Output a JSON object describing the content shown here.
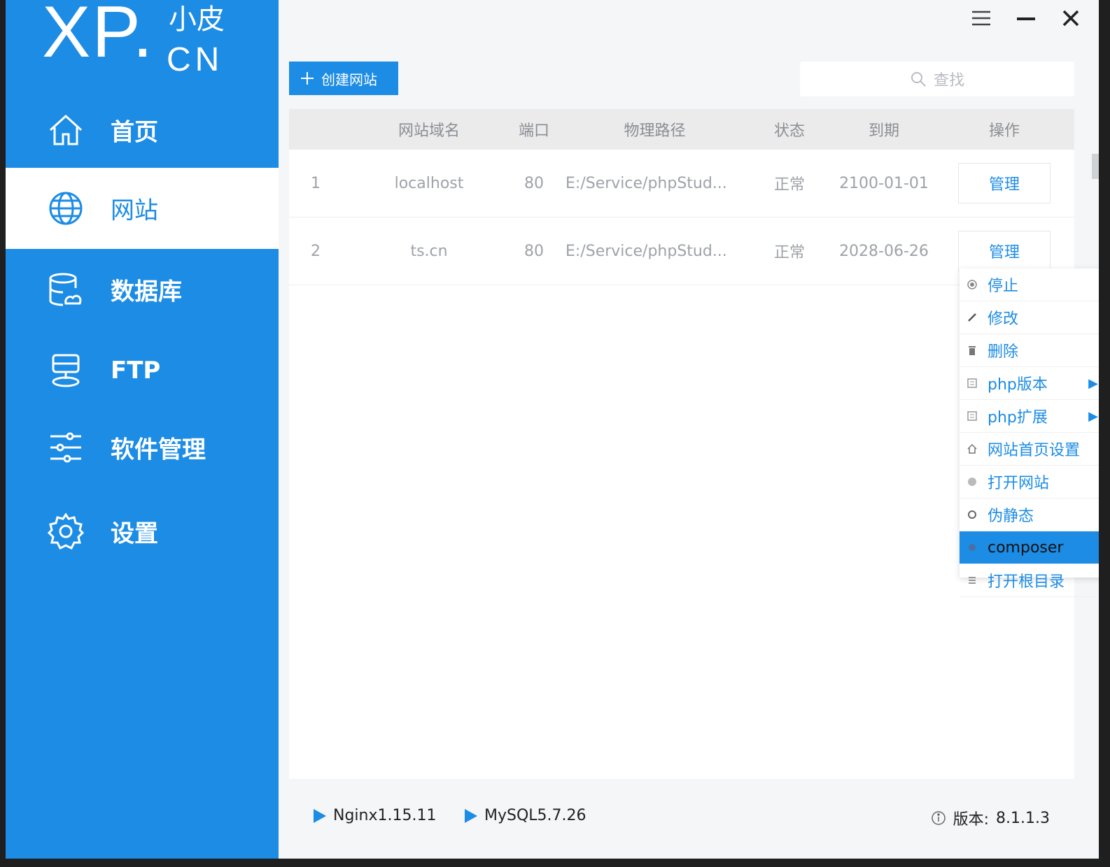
{
  "logo": {
    "main": "XP.",
    "small": "小皮",
    "suffix": "CN"
  },
  "sidebar": {
    "items": [
      {
        "label": "首页",
        "icon": "home-icon"
      },
      {
        "label": "网站",
        "icon": "globe-icon",
        "active": true
      },
      {
        "label": "数据库",
        "icon": "database-icon"
      },
      {
        "label": "FTP",
        "icon": "ftp-icon"
      },
      {
        "label": "软件管理",
        "icon": "sliders-icon"
      },
      {
        "label": "设置",
        "icon": "gear-icon"
      }
    ]
  },
  "toolbar": {
    "create_label": "创建网站",
    "search_placeholder": "查找"
  },
  "table": {
    "headers": [
      "网站域名",
      "端口",
      "物理路径",
      "状态",
      "到期",
      "操作"
    ],
    "rows": [
      {
        "idx": "1",
        "domain": "localhost",
        "port": "80",
        "path": "E:/Service/phpStud...",
        "status": "正常",
        "expire": "2100-01-01",
        "action": "管理"
      },
      {
        "idx": "2",
        "domain": "ts.cn",
        "port": "80",
        "path": "E:/Service/phpStud...",
        "status": "正常",
        "expire": "2028-06-26",
        "action": "管理"
      }
    ]
  },
  "context_menu": {
    "items": [
      {
        "label": "停止",
        "icon": "stop-icon"
      },
      {
        "label": "修改",
        "icon": "edit-icon"
      },
      {
        "label": "删除",
        "icon": "trash-icon"
      },
      {
        "label": "php版本",
        "icon": "php-version-icon",
        "submenu": true
      },
      {
        "label": "php扩展",
        "icon": "php-extension-icon",
        "submenu": true
      },
      {
        "label": "网站首页设置",
        "icon": "homepage-icon"
      },
      {
        "label": "打开网站",
        "icon": "open-site-icon"
      },
      {
        "label": "伪静态",
        "icon": "rewrite-icon"
      },
      {
        "label": "composer",
        "icon": "composer-icon",
        "highlighted": true
      },
      {
        "label": "打开根目录",
        "icon": "folder-list-icon"
      }
    ]
  },
  "statusbar": {
    "services": [
      "Nginx1.15.11",
      "MySQL5.7.26"
    ],
    "version_label": "版本:",
    "version": "8.1.1.3"
  },
  "colors": {
    "accent": "#1c8ce5",
    "sidebar_active_bg": "#ffffff"
  }
}
